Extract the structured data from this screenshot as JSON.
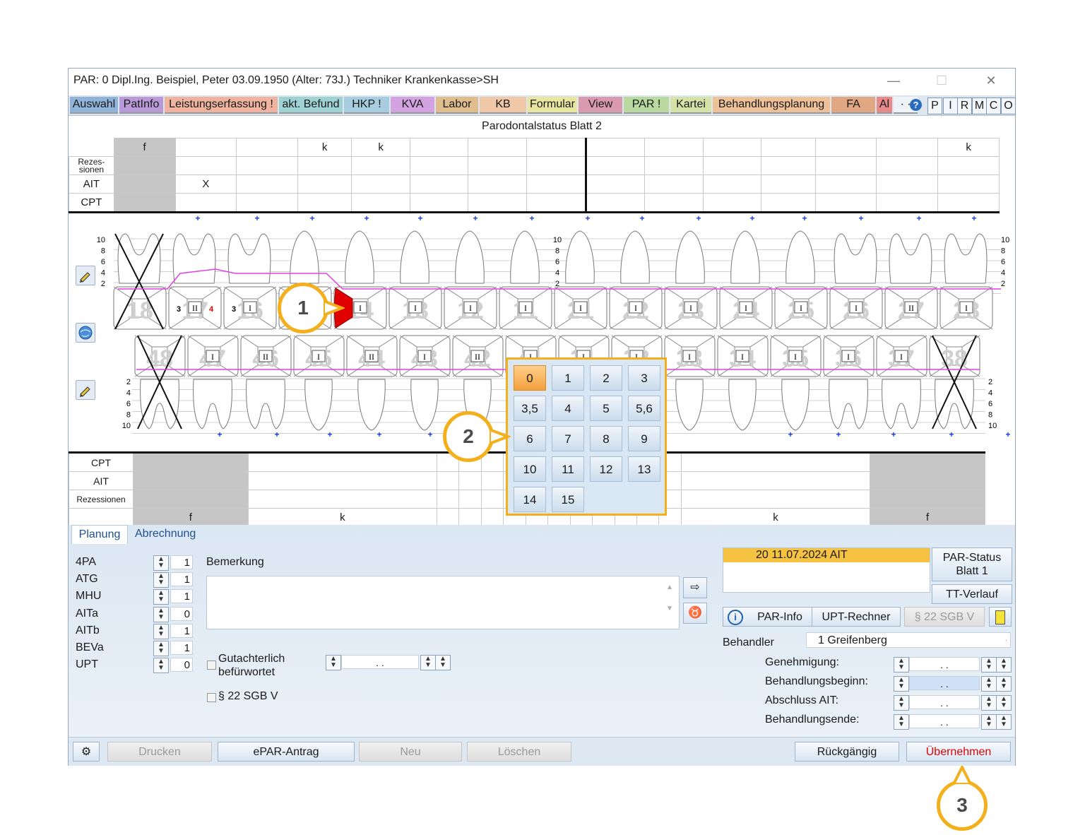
{
  "window": {
    "title": "PAR: 0  Dipl.Ing. Beispiel, Peter  03.09.1950 (Alter: 73J.)  Techniker Krankenkasse>SH",
    "minimize": "—",
    "maximize": "☐",
    "close": "✕"
  },
  "menu_tabs": [
    {
      "label": "Auswahl",
      "color": "#8fb3d9"
    },
    {
      "label": "PatInfo",
      "color": "#b89ad9"
    },
    {
      "label": "Leistungserfassung !",
      "color": "#f0b3a0"
    },
    {
      "label": "akt. Befund",
      "color": "#9fd3d3"
    },
    {
      "label": "HKP !",
      "color": "#a7cde0"
    },
    {
      "label": "KVA",
      "color": "#d2a3e0"
    },
    {
      "label": "Labor",
      "color": "#e0bd8c"
    },
    {
      "label": "KB",
      "color": "#f0c8a8"
    },
    {
      "label": "Formular",
      "color": "#e8e6a0"
    },
    {
      "label": "View",
      "color": "#d99ab0"
    },
    {
      "label": "PAR !",
      "color": "#b8d9a0"
    },
    {
      "label": "Kartei",
      "color": "#d5e2a8"
    },
    {
      "label": "Behandlungsplanung",
      "color": "#efc199"
    },
    {
      "label": "FA",
      "color": "#e0a882"
    },
    {
      "label": "Al",
      "color": "#e88a8a"
    }
  ],
  "menu_buttons": [
    "?",
    "P",
    "I",
    "R",
    "M",
    "C",
    "O"
  ],
  "chart_title": "Parodontalstatus Blatt 2",
  "upper_table": {
    "top_row": [
      "f",
      "",
      "",
      "k",
      "k",
      "",
      "",
      "",
      "",
      "",
      "",
      "",
      "",
      "",
      "k",
      ""
    ],
    "rows": [
      {
        "label": "Rezes-\nsionen",
        "cells": [
          "",
          "",
          "",
          "",
          "",
          "",
          "",
          "",
          "",
          "",
          "",
          "",
          "",
          "",
          "",
          ""
        ]
      },
      {
        "label": "AIT",
        "cells": [
          "",
          "X",
          "",
          "",
          "",
          "",
          "",
          "",
          "",
          "",
          "",
          "",
          "",
          "",
          "",
          ""
        ]
      },
      {
        "label": "CPT",
        "cells": [
          "",
          "",
          "",
          "",
          "",
          "",
          "",
          "",
          "",
          "",
          "",
          "",
          "",
          "",
          "",
          ""
        ]
      }
    ]
  },
  "upper_teeth": [
    {
      "num": "18",
      "mark": "",
      "extracted": true
    },
    {
      "num": "17",
      "mark": "II",
      "left": "3",
      "right": "4"
    },
    {
      "num": "16",
      "mark": "I",
      "left": "3",
      "right": ""
    },
    {
      "num": "15",
      "mark": ""
    },
    {
      "num": "14",
      "mark": "I",
      "red": true
    },
    {
      "num": "13",
      "mark": "I"
    },
    {
      "num": "12",
      "mark": "I"
    },
    {
      "num": "11",
      "mark": "I"
    },
    {
      "num": "21",
      "mark": "I"
    },
    {
      "num": "22",
      "mark": "I"
    },
    {
      "num": "23",
      "mark": "I"
    },
    {
      "num": "24",
      "mark": "I"
    },
    {
      "num": "25",
      "mark": "I"
    },
    {
      "num": "26",
      "mark": "I"
    },
    {
      "num": "27",
      "mark": "II"
    },
    {
      "num": "28",
      "mark": "I"
    }
  ],
  "lower_teeth": [
    {
      "num": "48",
      "mark": "",
      "extracted": true
    },
    {
      "num": "47",
      "mark": "I"
    },
    {
      "num": "46",
      "mark": "II"
    },
    {
      "num": "45",
      "mark": "I"
    },
    {
      "num": "44",
      "mark": "II"
    },
    {
      "num": "43",
      "mark": "I"
    },
    {
      "num": "42",
      "mark": "II"
    },
    {
      "num": "41",
      "mark": "I"
    },
    {
      "num": "31",
      "mark": "I"
    },
    {
      "num": "32",
      "mark": "I"
    },
    {
      "num": "33",
      "mark": "I"
    },
    {
      "num": "34",
      "mark": "I"
    },
    {
      "num": "35",
      "mark": "I"
    },
    {
      "num": "36",
      "mark": "I"
    },
    {
      "num": "37",
      "mark": "I"
    },
    {
      "num": "38",
      "mark": "",
      "extracted": true
    }
  ],
  "scale_upper": [
    "10",
    "8",
    "6",
    "4",
    "2"
  ],
  "scale_lower": [
    "2",
    "4",
    "6",
    "8",
    "10"
  ],
  "lower_table": {
    "rows": [
      {
        "label": "CPT"
      },
      {
        "label": "AIT"
      },
      {
        "label": "Rezessionen"
      }
    ],
    "bottom_row": [
      "f",
      "k",
      "",
      "",
      "",
      "",
      "",
      "",
      "",
      "",
      "",
      "",
      "",
      "",
      "k",
      "f"
    ]
  },
  "numpad": {
    "keys": [
      "0",
      "1",
      "2",
      "3",
      "3,5",
      "4",
      "5",
      "5,6",
      "6",
      "7",
      "8",
      "9",
      "10",
      "11",
      "12",
      "13",
      "14",
      "15"
    ],
    "selected": "0"
  },
  "callouts": [
    "1",
    "2",
    "3"
  ],
  "planning": {
    "tabs": [
      "Planung",
      "Abrechnung"
    ],
    "counters": [
      {
        "label": "4PA",
        "value": "1"
      },
      {
        "label": "ATG",
        "value": "1"
      },
      {
        "label": "MHU",
        "value": "1"
      },
      {
        "label": "AITa",
        "value": "0"
      },
      {
        "label": "AITb",
        "value": "1"
      },
      {
        "label": "BEVa",
        "value": "1"
      },
      {
        "label": "UPT",
        "value": "0"
      }
    ],
    "remark_label": "Bemerkung",
    "gutachter_label": "Gutachterlich\nbefürwortet",
    "gutachter_date": ".   .",
    "sgb_label": "§ 22 SGB V",
    "list_entry": "20  11.07.2024  AIT",
    "par_status_btn": "PAR-Status\nBlatt 1",
    "tt_verlauf_btn": "TT-Verlauf",
    "par_info_btn": "PAR-Info",
    "upt_rechner_btn": "UPT-Rechner",
    "sgb_btn": "§ 22 SGB V",
    "behandler_label": "Behandler",
    "behandler_value": "1 Greifenberg",
    "dates": [
      {
        "label": "Genehmigung:",
        "value": ".   ."
      },
      {
        "label": "Behandlungsbeginn:",
        "value": ".   ."
      },
      {
        "label": "Abschluss AIT:",
        "value": ".   ."
      },
      {
        "label": "Behandlungsende:",
        "value": ".   ."
      }
    ]
  },
  "footer": {
    "drucken": "Drucken",
    "epar": "ePAR-Antrag",
    "neu": "Neu",
    "loeschen": "Löschen",
    "rueckgaengig": "Rückgängig",
    "uebernehmen": "Übernehmen"
  },
  "colors": {
    "accent": "#f3b01c",
    "selected_key": "#f3a03c",
    "probe_line": "#e040e0",
    "red_tooth": "#e00000",
    "list_highlight": "#f5c242",
    "ok_text": "#e00000"
  }
}
